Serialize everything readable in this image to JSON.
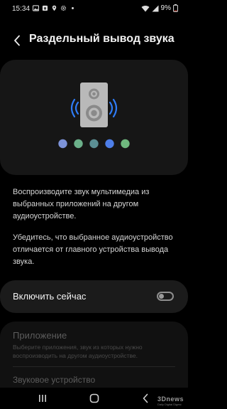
{
  "status_bar": {
    "time": "15:34",
    "battery": "9%",
    "icons_left": [
      "image-icon",
      "upload-icon",
      "location-icon",
      "gear-icon",
      "dot-icon"
    ],
    "icons_right": [
      "wifi-icon",
      "signal-icon",
      "battery-icon"
    ]
  },
  "header": {
    "back_icon": "chevron-left-icon",
    "title": "Раздельный вывод звука"
  },
  "illustration": {
    "icon": "speaker-icon",
    "dot_colors": [
      "#7d93d9",
      "#6bb08a",
      "#5b8f94",
      "#4d7ee8",
      "#6fb87e"
    ],
    "accent_color": "#2f7cf6"
  },
  "description": {
    "paragraph1": "Воспроизводите звук мультимедиа из выбранных приложений на другом аудиоустройстве.",
    "paragraph2": "Убедитесь, что выбранное аудиоустройство отличается от главного устройства вывода звука."
  },
  "toggle": {
    "label": "Включить сейчас",
    "enabled": false
  },
  "app_section": {
    "title": "Приложение",
    "subtitle": "Выберите приложения, звук из которых нужно воспроизводить на другом аудиоустройстве."
  },
  "device_section": {
    "title": "Звуковое устройство"
  },
  "nav_bar": {
    "buttons": [
      "recent-apps-icon",
      "home-icon",
      "back-icon"
    ],
    "watermark": "3Dnews",
    "watermark_sub": "Daily Digital Digest"
  }
}
